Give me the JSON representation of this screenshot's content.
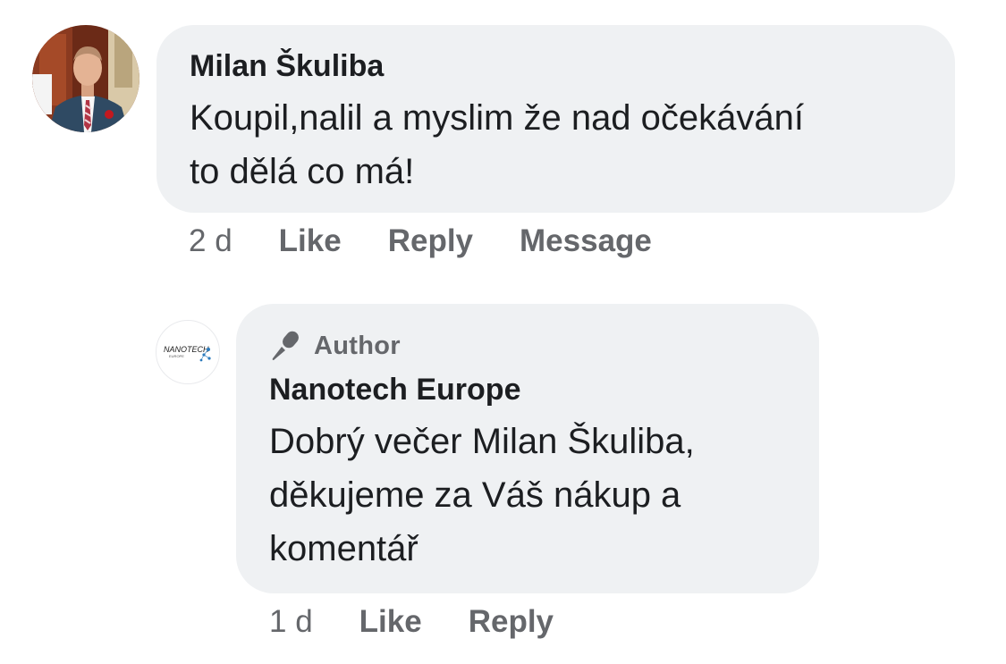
{
  "comment": {
    "author_name": "Milan Škuliba",
    "text_line1": "Koupil,nalil a myslim že nad očekávání",
    "text_line2": "to dělá co má!",
    "time": "2 d",
    "actions": [
      "Like",
      "Reply",
      "Message"
    ]
  },
  "reply": {
    "badge_label": "Author",
    "author_name": "Nanotech Europe",
    "logo_text": "NANOTECH",
    "logo_subtext": "EUROPE",
    "text_line1": "Dobrý večer Milan Škuliba,",
    "text_line2": "děkujeme za Váš nákup a",
    "text_line3": "komentář",
    "time": "1 d",
    "actions": [
      "Like",
      "Reply"
    ]
  },
  "colors": {
    "bubble": "#eff1f3",
    "secondary_text": "#65676b",
    "primary_text": "#1c1e21"
  },
  "icons": {
    "author_badge": "microphone-icon"
  }
}
